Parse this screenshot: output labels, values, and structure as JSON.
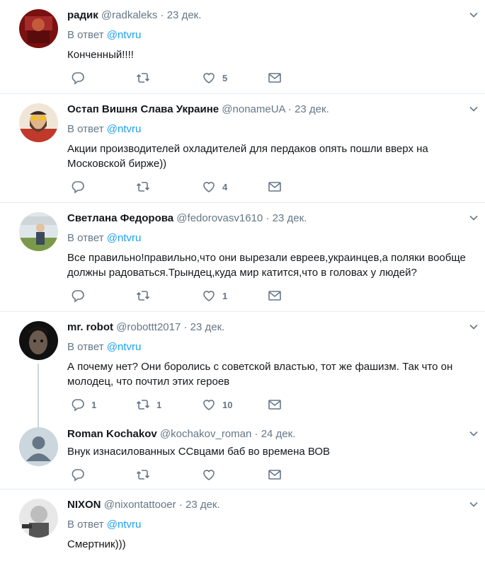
{
  "tweets": [
    {
      "name": "радик",
      "handle": "@radkaleks",
      "date": "23 дек.",
      "reply_prefix": "В ответ",
      "reply_to": "@ntvru",
      "text": "Конченный!!!!",
      "replies": "",
      "retweets": "",
      "likes": "5",
      "avatar": "red-portrait"
    },
    {
      "name": "Остап Вишня Слава Украине",
      "handle": "@nonameUA",
      "date": "23 дек.",
      "reply_prefix": "В ответ",
      "reply_to": "@ntvru",
      "text": "Акции производителей охладителей для пердаков опять пошли вверх на Московской бирже))",
      "replies": "",
      "retweets": "",
      "likes": "4",
      "avatar": "cartoon-bearded-man"
    },
    {
      "name": "Светлана Федорова",
      "handle": "@fedorovasv1610",
      "date": "23 дек.",
      "reply_prefix": "В ответ",
      "reply_to": "@ntvru",
      "text": "Все правильно!правильно,что они вырезали евреев,украинцев,а поляки вообще должны радоваться.Трындец,куда мир катится,что в головах у людей?",
      "replies": "",
      "retweets": "",
      "likes": "1",
      "avatar": "woman-outdoors"
    },
    {
      "name": "mr. robot",
      "handle": "@robottt2017",
      "date": "23 дек.",
      "reply_prefix": "В ответ",
      "reply_to": "@ntvru",
      "text": "А почему нет? Они боролись с советской властью, тот же фашизм. Так что он молодец, что почтил этих героев",
      "replies": "1",
      "retweets": "1",
      "likes": "10",
      "avatar": "dark-face"
    },
    {
      "name": "Roman Kochakov",
      "handle": "@kochakov_roman",
      "date": "24 дек.",
      "reply_prefix": "",
      "reply_to": "",
      "text": "Внук изнасилованных ССвцами баб во времена ВОВ",
      "replies": "",
      "retweets": "",
      "likes": "",
      "avatar": "default-silhouette"
    },
    {
      "name": "NIXON",
      "handle": "@nixontattooer",
      "date": "23 дек.",
      "reply_prefix": "В ответ",
      "reply_to": "@ntvru",
      "text": "Смертник)))",
      "replies": "",
      "retweets": "",
      "likes": "",
      "avatar": "bw-child-photo"
    }
  ],
  "colors": {
    "accent": "#1da1f2",
    "muted": "#657786",
    "border": "#e6ecf0"
  }
}
